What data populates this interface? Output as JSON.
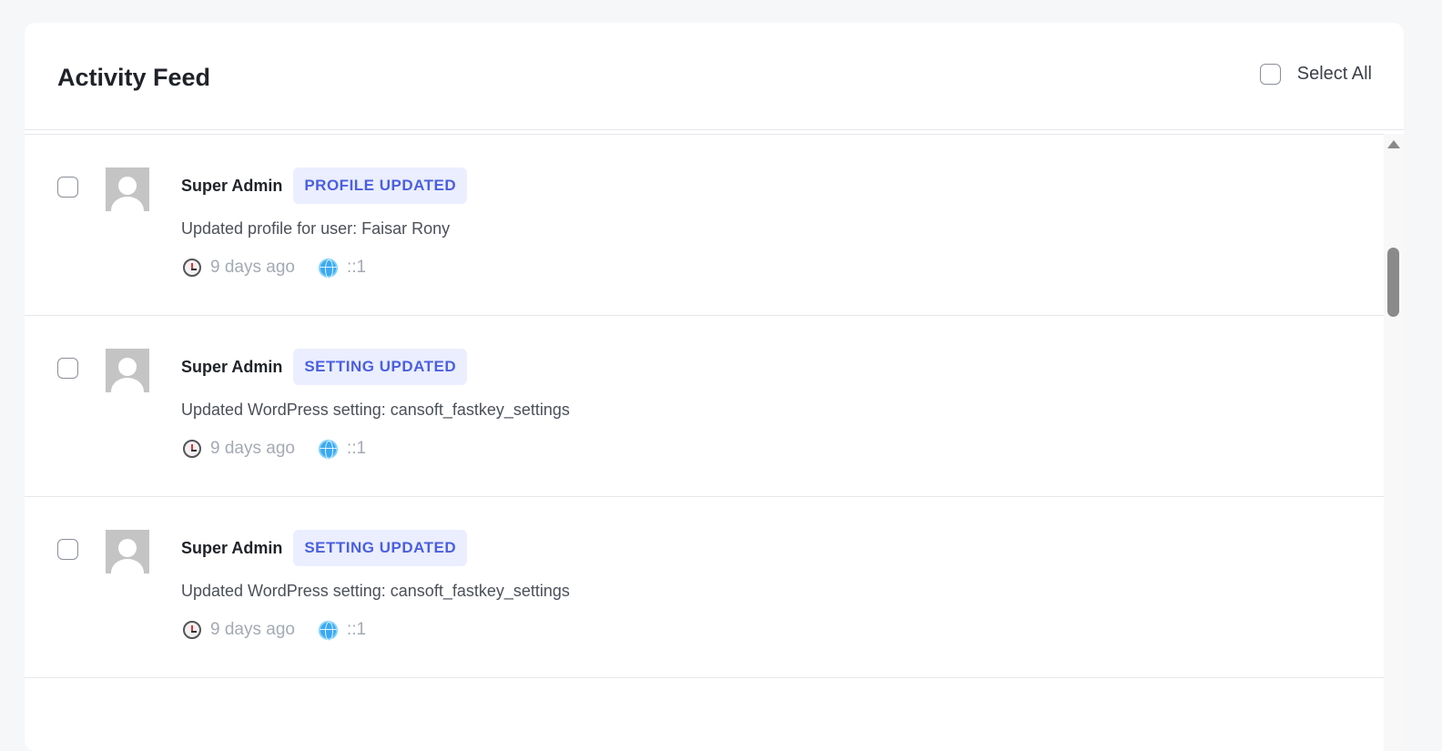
{
  "header": {
    "title": "Activity Feed",
    "select_all_label": "Select All"
  },
  "activities": [
    {
      "user": "Super Admin",
      "badge": "PROFILE UPDATED",
      "description": "Updated profile for user: Faisar Rony",
      "time": "9 days ago",
      "ip": "::1"
    },
    {
      "user": "Super Admin",
      "badge": "SETTING UPDATED",
      "description": "Updated WordPress setting: cansoft_fastkey_settings",
      "time": "9 days ago",
      "ip": "::1"
    },
    {
      "user": "Super Admin",
      "badge": "SETTING UPDATED",
      "description": "Updated WordPress setting: cansoft_fastkey_settings",
      "time": "9 days ago",
      "ip": "::1"
    }
  ],
  "colors": {
    "badge_bg": "#ebeefe",
    "badge_text": "#4a5fe0"
  }
}
